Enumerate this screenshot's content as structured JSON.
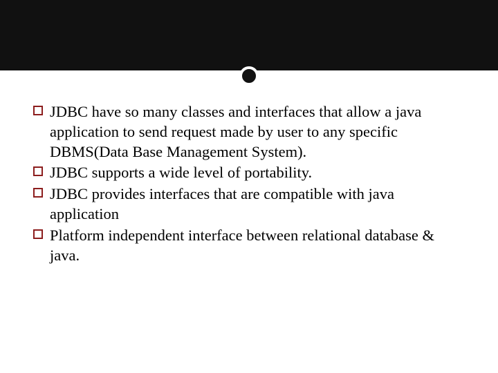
{
  "slide": {
    "bullets": [
      "JDBC have so many classes and interfaces that allow a java application to send request made by user to any specific DBMS(Data Base Management System).",
      "JDBC supports a wide level of portability.",
      "JDBC provides interfaces that are compatible with java application",
      "Platform independent interface between relational database & java."
    ],
    "bullet_marker": "hollow-square",
    "bullet_color": "#8c1d1d"
  },
  "chart_data": null
}
